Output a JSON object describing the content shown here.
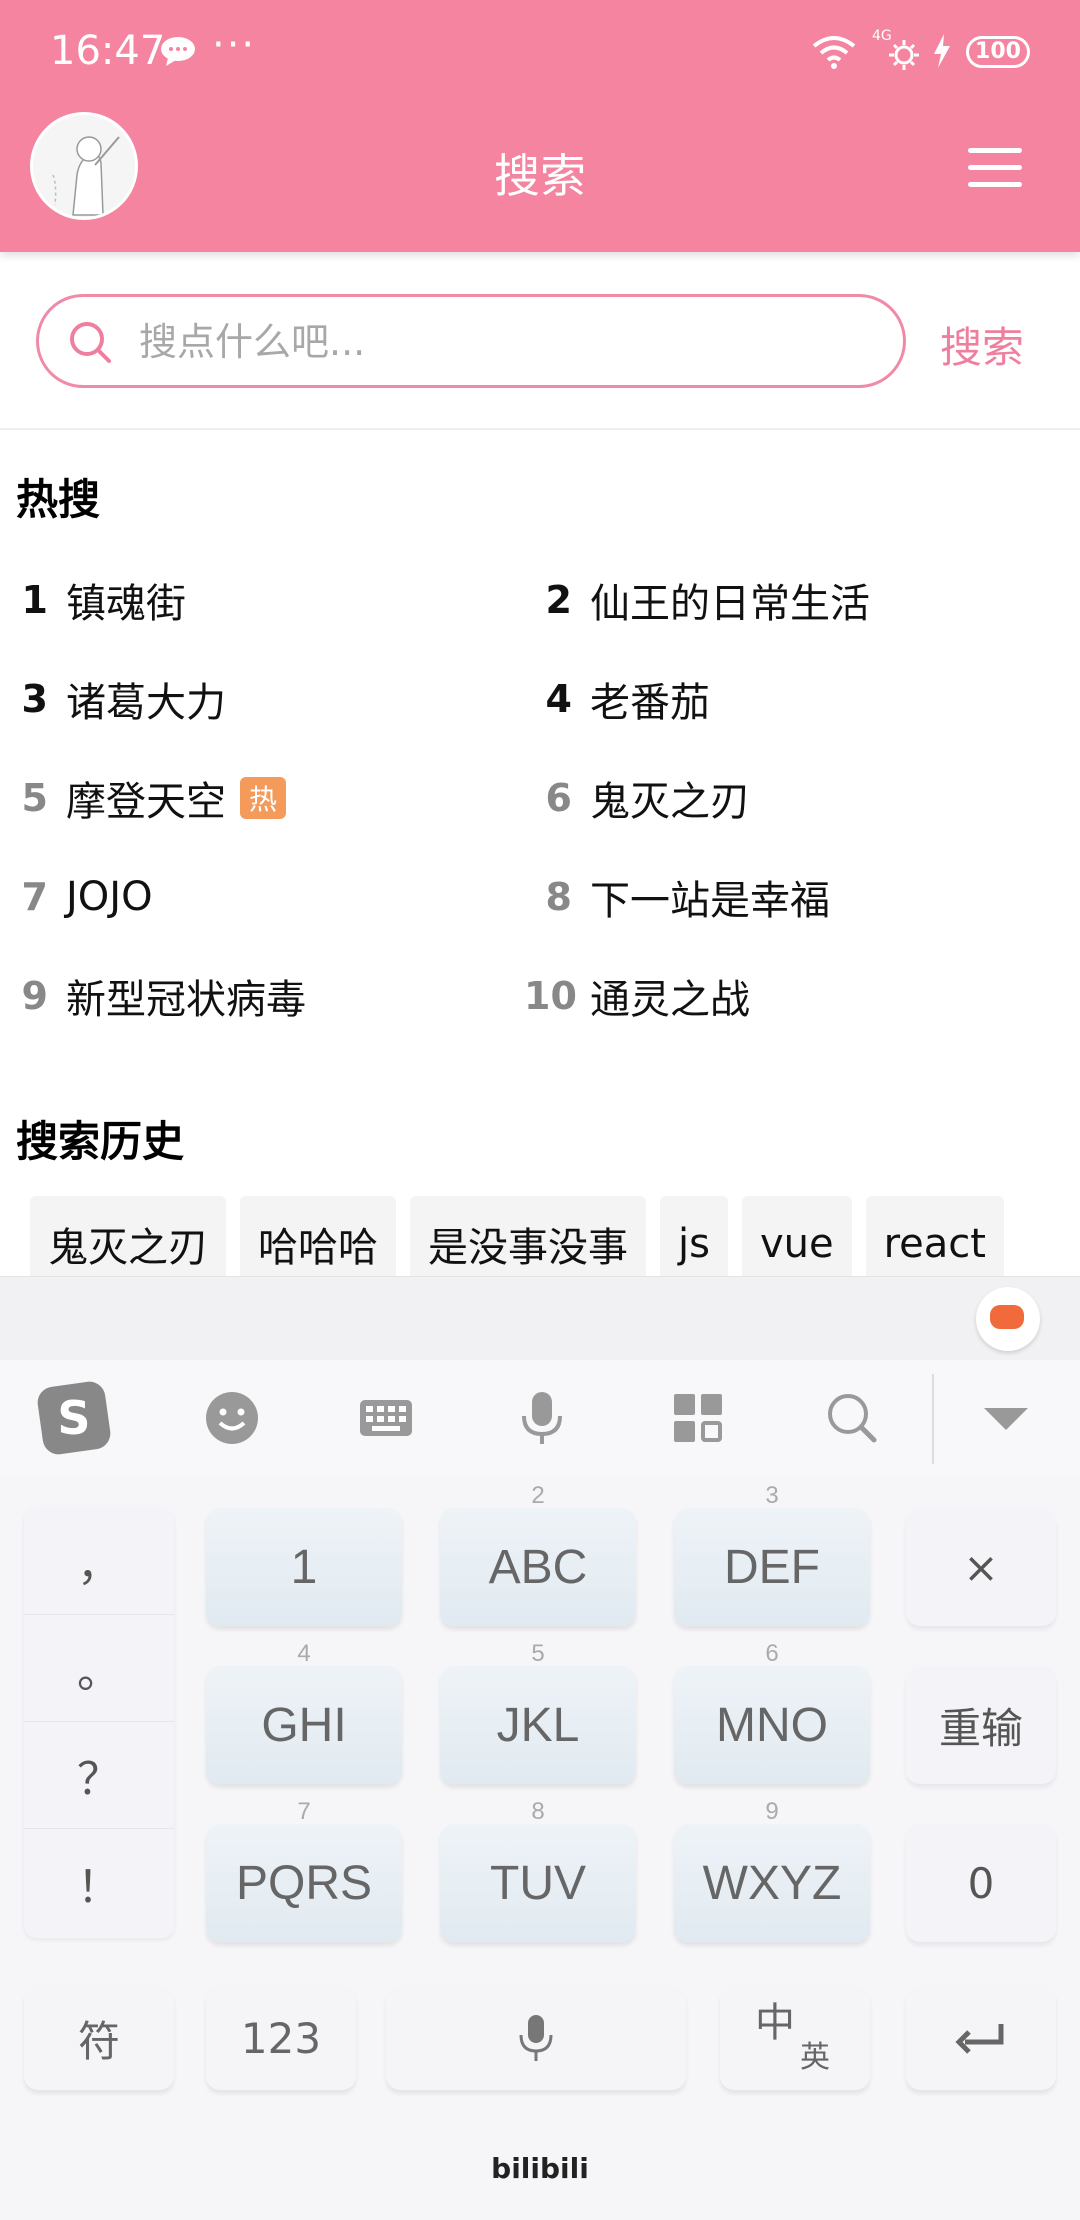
{
  "status_bar": {
    "time": "16:47",
    "dots": "···",
    "network": "4G",
    "battery": "100"
  },
  "header": {
    "title": "搜索",
    "background": "#f4849f"
  },
  "search": {
    "placeholder": "搜点什么吧...",
    "value": "",
    "button_label": "搜索"
  },
  "hot": {
    "title": "热搜",
    "items": [
      {
        "rank": "1",
        "text": "镇魂街"
      },
      {
        "rank": "2",
        "text": "仙王的日常生活"
      },
      {
        "rank": "3",
        "text": "诸葛大力"
      },
      {
        "rank": "4",
        "text": "老番茄"
      },
      {
        "rank": "5",
        "text": "摩登天空",
        "tag": "热"
      },
      {
        "rank": "6",
        "text": "鬼灭之刃"
      },
      {
        "rank": "7",
        "text": "JOJO"
      },
      {
        "rank": "8",
        "text": "下一站是幸福"
      },
      {
        "rank": "9",
        "text": "新型冠状病毒"
      },
      {
        "rank": "10",
        "text": "通灵之战"
      }
    ]
  },
  "history": {
    "title": "搜索历史",
    "items": [
      "鬼灭之刃",
      "哈哈哈",
      "是没事没事",
      "js",
      "vue",
      "react"
    ]
  },
  "keyboard": {
    "toolbar": [
      "sogou-logo-icon",
      "emoji-icon",
      "keyboard-icon",
      "microphone-icon",
      "apps-grid-icon",
      "search-icon",
      "collapse-icon"
    ],
    "punctuation": [
      "，",
      "。",
      "？",
      "！"
    ],
    "keys": [
      {
        "num": "",
        "label": "1"
      },
      {
        "num": "2",
        "label": "ABC"
      },
      {
        "num": "3",
        "label": "DEF"
      },
      {
        "num": "4",
        "label": "GHI"
      },
      {
        "num": "5",
        "label": "JKL"
      },
      {
        "num": "6",
        "label": "MNO"
      },
      {
        "num": "7",
        "label": "PQRS"
      },
      {
        "num": "8",
        "label": "TUV"
      },
      {
        "num": "9",
        "label": "WXYZ"
      }
    ],
    "right_keys": [
      "×",
      "重输",
      "0"
    ],
    "bottom": {
      "symbols": "符",
      "numbers": "123",
      "lang_zh": "中",
      "lang_en": "英"
    },
    "brand": "bilibili"
  }
}
